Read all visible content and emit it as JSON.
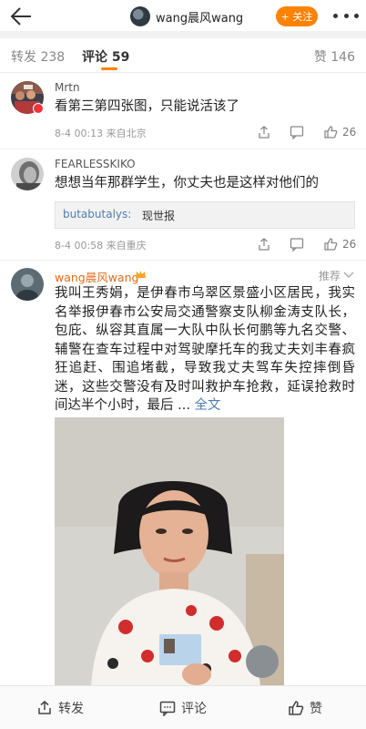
{
  "header": {
    "username": "wang晨风wang",
    "follow_label": "+ 关注"
  },
  "tabs": [
    {
      "label": "转发 238"
    },
    {
      "label": "评论 59"
    },
    {
      "label": "赞 146"
    }
  ],
  "comments": [
    {
      "user": "Mrtn",
      "text": "看第三第四张图，只能说活该了",
      "meta": "8-4 00:13  来自北京",
      "likes": "26"
    },
    {
      "user": "FEARLESSKIKO",
      "text": "想想当年那群学生，你丈夫也是这样对他们的",
      "reply_user": "butabutalys:",
      "reply_text": "现世报",
      "meta": "8-4 00:58  来自重庆",
      "likes": "26"
    }
  ],
  "post": {
    "user": "wang晨风wang",
    "recommend_label": "推荐",
    "text": "我叫王秀娟，是伊春市乌翠区景盛小区居民，我实名举报伊春市公安局交通警察支队柳金涛支队长，包庇、纵容其直属一大队中队长何鹏等九名交警、辅警在查车过程中对驾驶摩托车的我丈夫刘丰春疯狂追赶、围追堵截，导致我丈夫驾车失控摔倒昏迷，这些交警没有及时叫救护车抢救，延误抢救时间达半个小时，最后 ... ",
    "full_text_label": "全文"
  },
  "bottom": {
    "repost": "转发",
    "comment": "评论",
    "like": "赞"
  },
  "colors": {
    "accent": "#ff8200",
    "link": "#507daf"
  }
}
